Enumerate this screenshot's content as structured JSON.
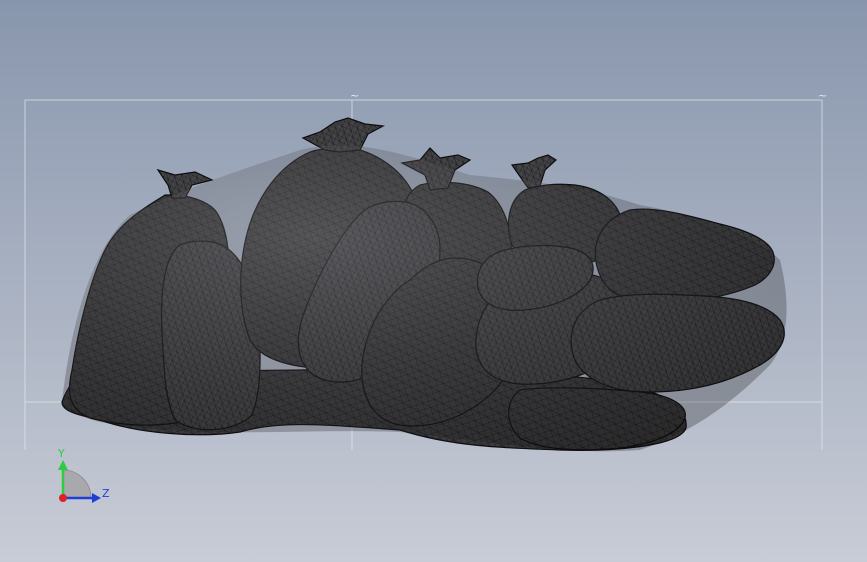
{
  "viewport": {
    "background_top": "#8896ad",
    "background_bottom": "#c8ccd6",
    "mesh_fill": "#3a3a3c",
    "mesh_line": "#141416",
    "mesh_highlight": "#6a6a6e",
    "bounding_box_color": "#e8eaee"
  },
  "model": {
    "icon": "garbage-bags-mesh-icon"
  },
  "triad": {
    "y_label": "Y",
    "z_label": "Z",
    "y_color": "#2ecc40",
    "z_color": "#1f3fd6",
    "x_color": "#e02020",
    "icon": "axis-triad-icon"
  }
}
